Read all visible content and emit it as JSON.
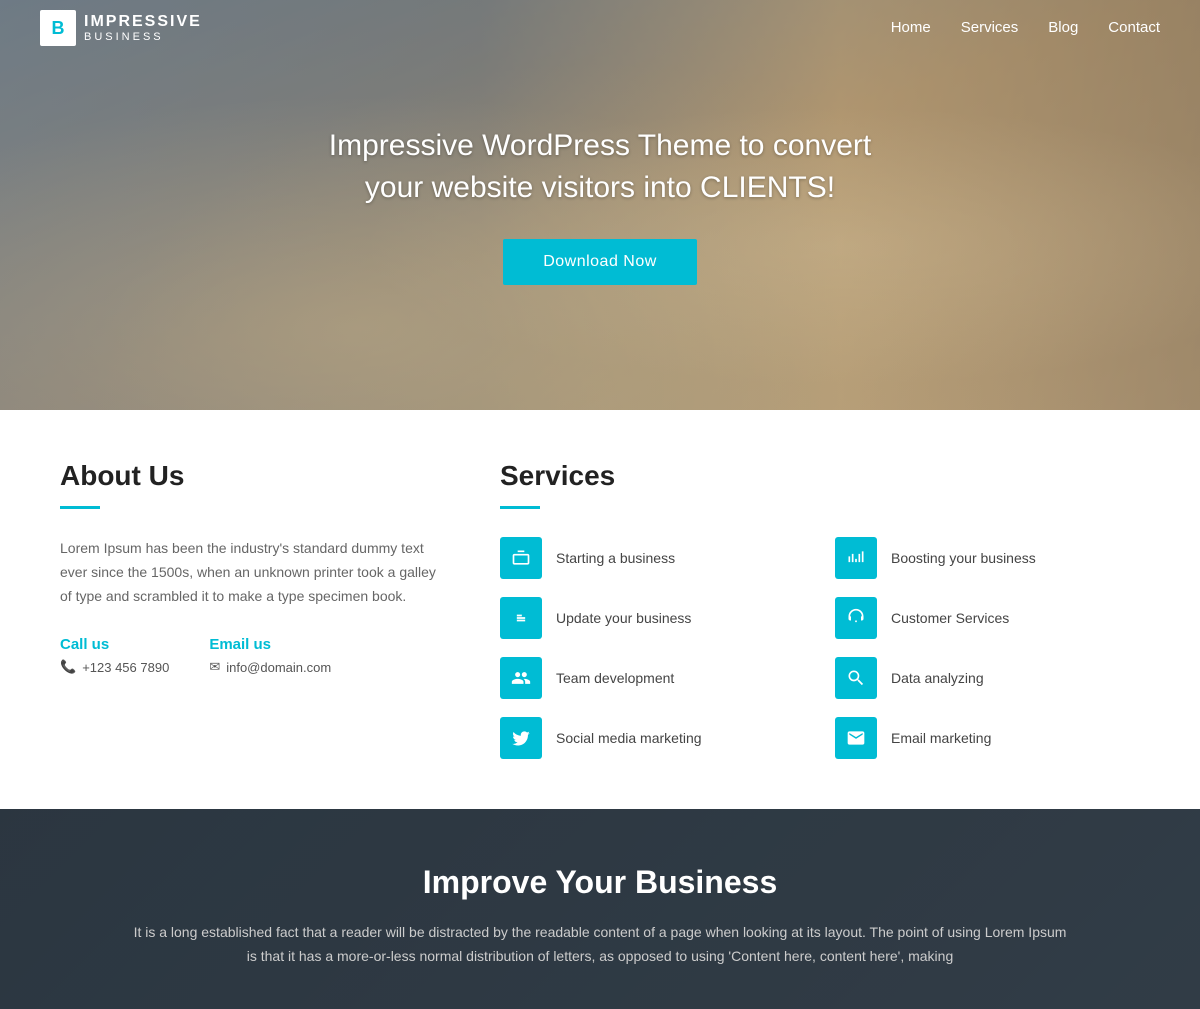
{
  "nav": {
    "logo_letter": "B",
    "logo_line1": "IMPRESSIVE",
    "logo_line2": "BUSINESS",
    "links": [
      {
        "label": "Home",
        "href": "#"
      },
      {
        "label": "Services",
        "href": "#"
      },
      {
        "label": "Blog",
        "href": "#"
      },
      {
        "label": "Contact",
        "href": "#"
      }
    ]
  },
  "hero": {
    "title_line1": "Impressive WordPress Theme to convert",
    "title_line2": "your website visitors into CLIENTS!",
    "cta_label": "Download Now"
  },
  "about": {
    "title": "About Us",
    "body": "Lorem Ipsum has been the industry's standard dummy text ever since the 1500s, when an unknown printer took a galley of type and scrambled it to make a type specimen book.",
    "call_label": "Call us",
    "call_value": "+123 456 7890",
    "email_label": "Email us",
    "email_value": "info@domain.com"
  },
  "services": {
    "title": "Services",
    "items": [
      {
        "label": "Starting a business",
        "icon": "briefcase",
        "col": 0
      },
      {
        "label": "Boosting your business",
        "icon": "chart",
        "col": 1
      },
      {
        "label": "Update your business",
        "icon": "arrows",
        "col": 0
      },
      {
        "label": "Customer Services",
        "icon": "headset",
        "col": 1
      },
      {
        "label": "Team development",
        "icon": "team",
        "col": 0
      },
      {
        "label": "Data analyzing",
        "icon": "search",
        "col": 1
      },
      {
        "label": "Social media marketing",
        "icon": "twitter",
        "col": 0
      },
      {
        "label": "Email marketing",
        "icon": "envelope",
        "col": 1
      }
    ]
  },
  "cta": {
    "title": "Improve Your Business",
    "text": "It is a long established fact that a reader will be distracted by the readable content of a page when looking at its layout. The point of using Lorem Ipsum is that it has a more-or-less normal distribution of letters, as opposed to using 'Content here, content here', making"
  }
}
